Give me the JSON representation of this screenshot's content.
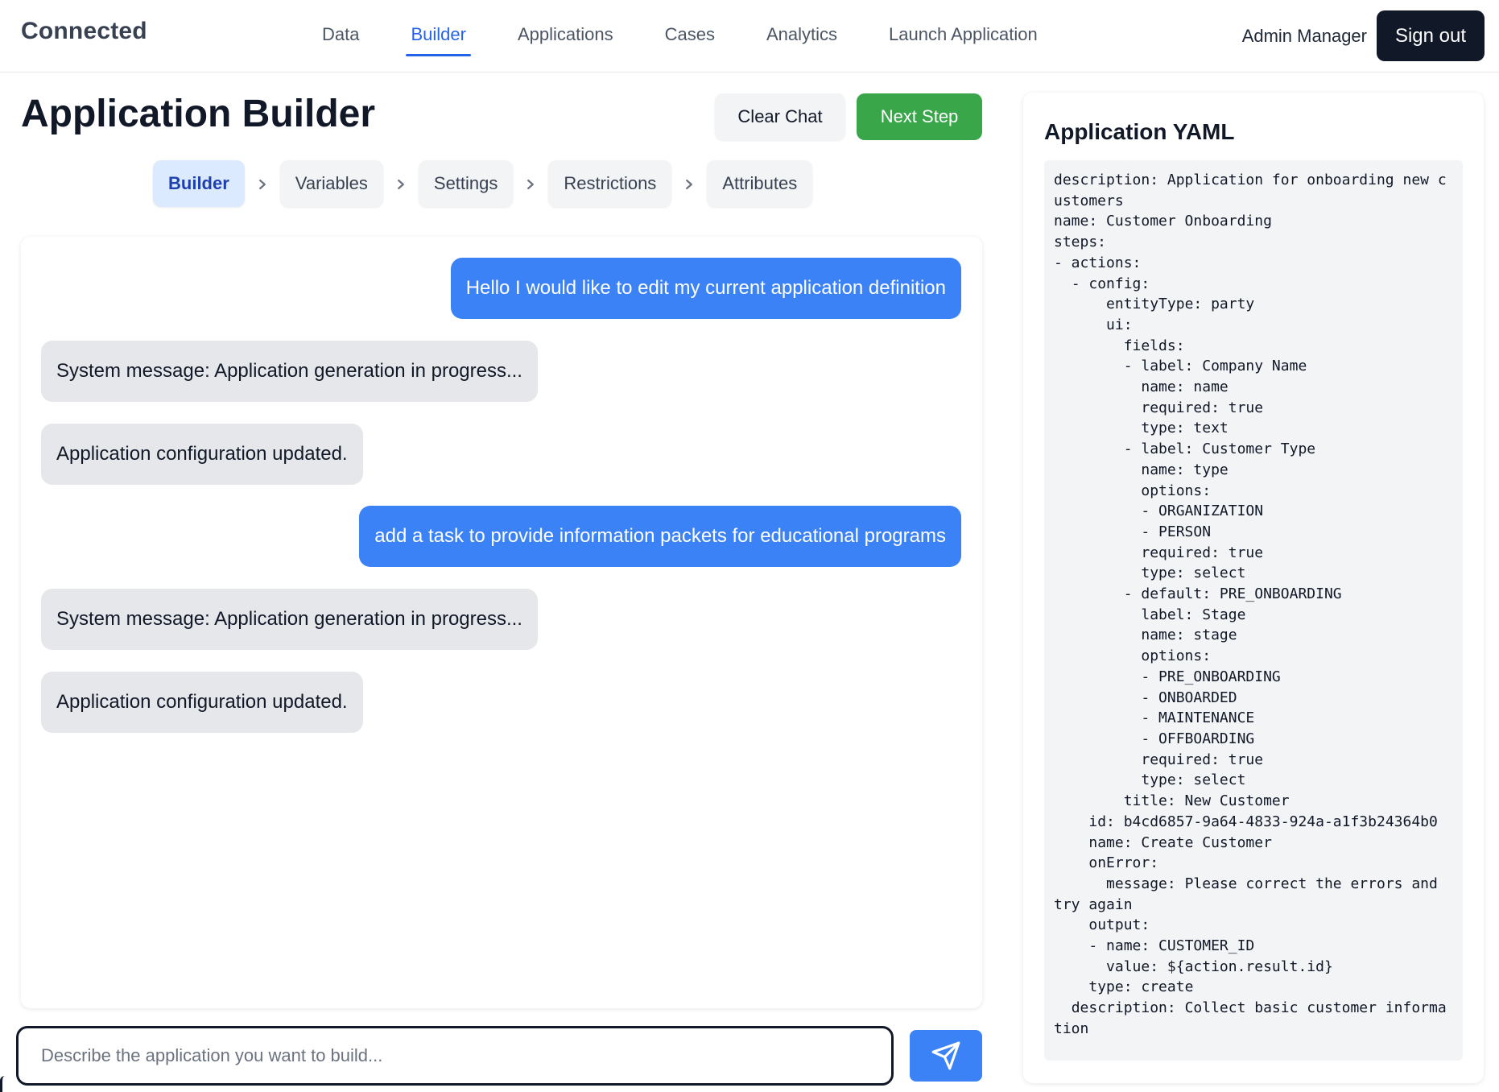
{
  "header": {
    "brand": "Connected",
    "nav": [
      {
        "label": "Data",
        "active": false
      },
      {
        "label": "Builder",
        "active": true
      },
      {
        "label": "Applications",
        "active": false
      },
      {
        "label": "Cases",
        "active": false
      },
      {
        "label": "Analytics",
        "active": false
      },
      {
        "label": "Launch Application",
        "active": false
      }
    ],
    "user_name": "Admin Manager",
    "sign_out_label": "Sign out"
  },
  "builder": {
    "title": "Application Builder",
    "clear_chat_label": "Clear Chat",
    "next_step_label": "Next Step",
    "steps": [
      {
        "label": "Builder",
        "active": true
      },
      {
        "label": "Variables",
        "active": false
      },
      {
        "label": "Settings",
        "active": false
      },
      {
        "label": "Restrictions",
        "active": false
      },
      {
        "label": "Attributes",
        "active": false
      }
    ]
  },
  "chat": {
    "messages": [
      {
        "role": "user",
        "text": "Hello I would like to edit my current application definition"
      },
      {
        "role": "system",
        "text": "System message: Application generation in progress..."
      },
      {
        "role": "system",
        "text": "Application configuration updated."
      },
      {
        "role": "user",
        "text": "add a task to provide information packets for educational programs"
      },
      {
        "role": "system",
        "text": "System message: Application generation in progress..."
      },
      {
        "role": "system",
        "text": "Application configuration updated."
      }
    ],
    "input_placeholder": "Describe the application you want to build...",
    "input_value": ""
  },
  "yaml_panel": {
    "title": "Application YAML",
    "content": "description: Application for onboarding new customers\nname: Customer Onboarding\nsteps:\n- actions:\n  - config:\n      entityType: party\n      ui:\n        fields:\n        - label: Company Name\n          name: name\n          required: true\n          type: text\n        - label: Customer Type\n          name: type\n          options:\n          - ORGANIZATION\n          - PERSON\n          required: true\n          type: select\n        - default: PRE_ONBOARDING\n          label: Stage\n          name: stage\n          options:\n          - PRE_ONBOARDING\n          - ONBOARDED\n          - MAINTENANCE\n          - OFFBOARDING\n          required: true\n          type: select\n        title: New Customer\n    id: b4cd6857-9a64-4833-924a-a1f3b24364b0\n    name: Create Customer\n    onError:\n      message: Please correct the errors and try again\n    output:\n    - name: CUSTOMER_ID\n      value: ${action.result.id}\n    type: create\n  description: Collect basic customer information"
  },
  "colors": {
    "accent": "#3b82f6",
    "active_nav": "#2563eb",
    "success": "#3aa64a",
    "dark": "#111827"
  }
}
